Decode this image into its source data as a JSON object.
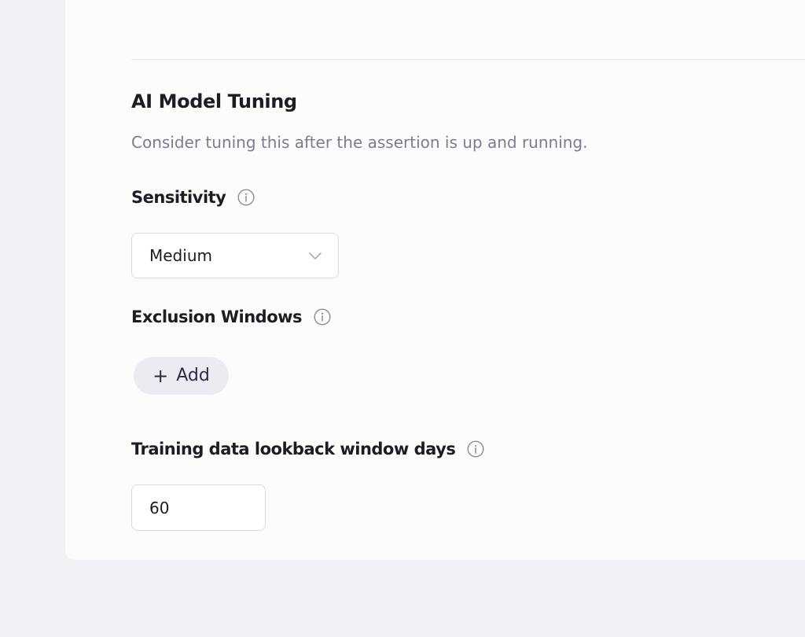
{
  "section": {
    "title": "AI Model Tuning",
    "description": "Consider tuning this after the assertion is up and running."
  },
  "sensitivity": {
    "label": "Sensitivity",
    "info_icon": "info-icon",
    "selected_value": "Medium",
    "dropdown_icon": "chevron-down-icon"
  },
  "exclusion_windows": {
    "label": "Exclusion Windows",
    "info_icon": "info-icon",
    "add_button": {
      "icon": "plus-icon",
      "label": "Add"
    }
  },
  "training_lookback": {
    "label": "Training data lookback window days",
    "info_icon": "info-icon",
    "value": "60"
  },
  "colors": {
    "page_background": "#f1f1f6",
    "card_background": "#fcfcfc",
    "heading_text": "#1c1c24",
    "muted_text": "#7b7c92",
    "button_background": "#ebecf1",
    "button_text": "#2a2c48",
    "input_border": "#d9d9de"
  }
}
